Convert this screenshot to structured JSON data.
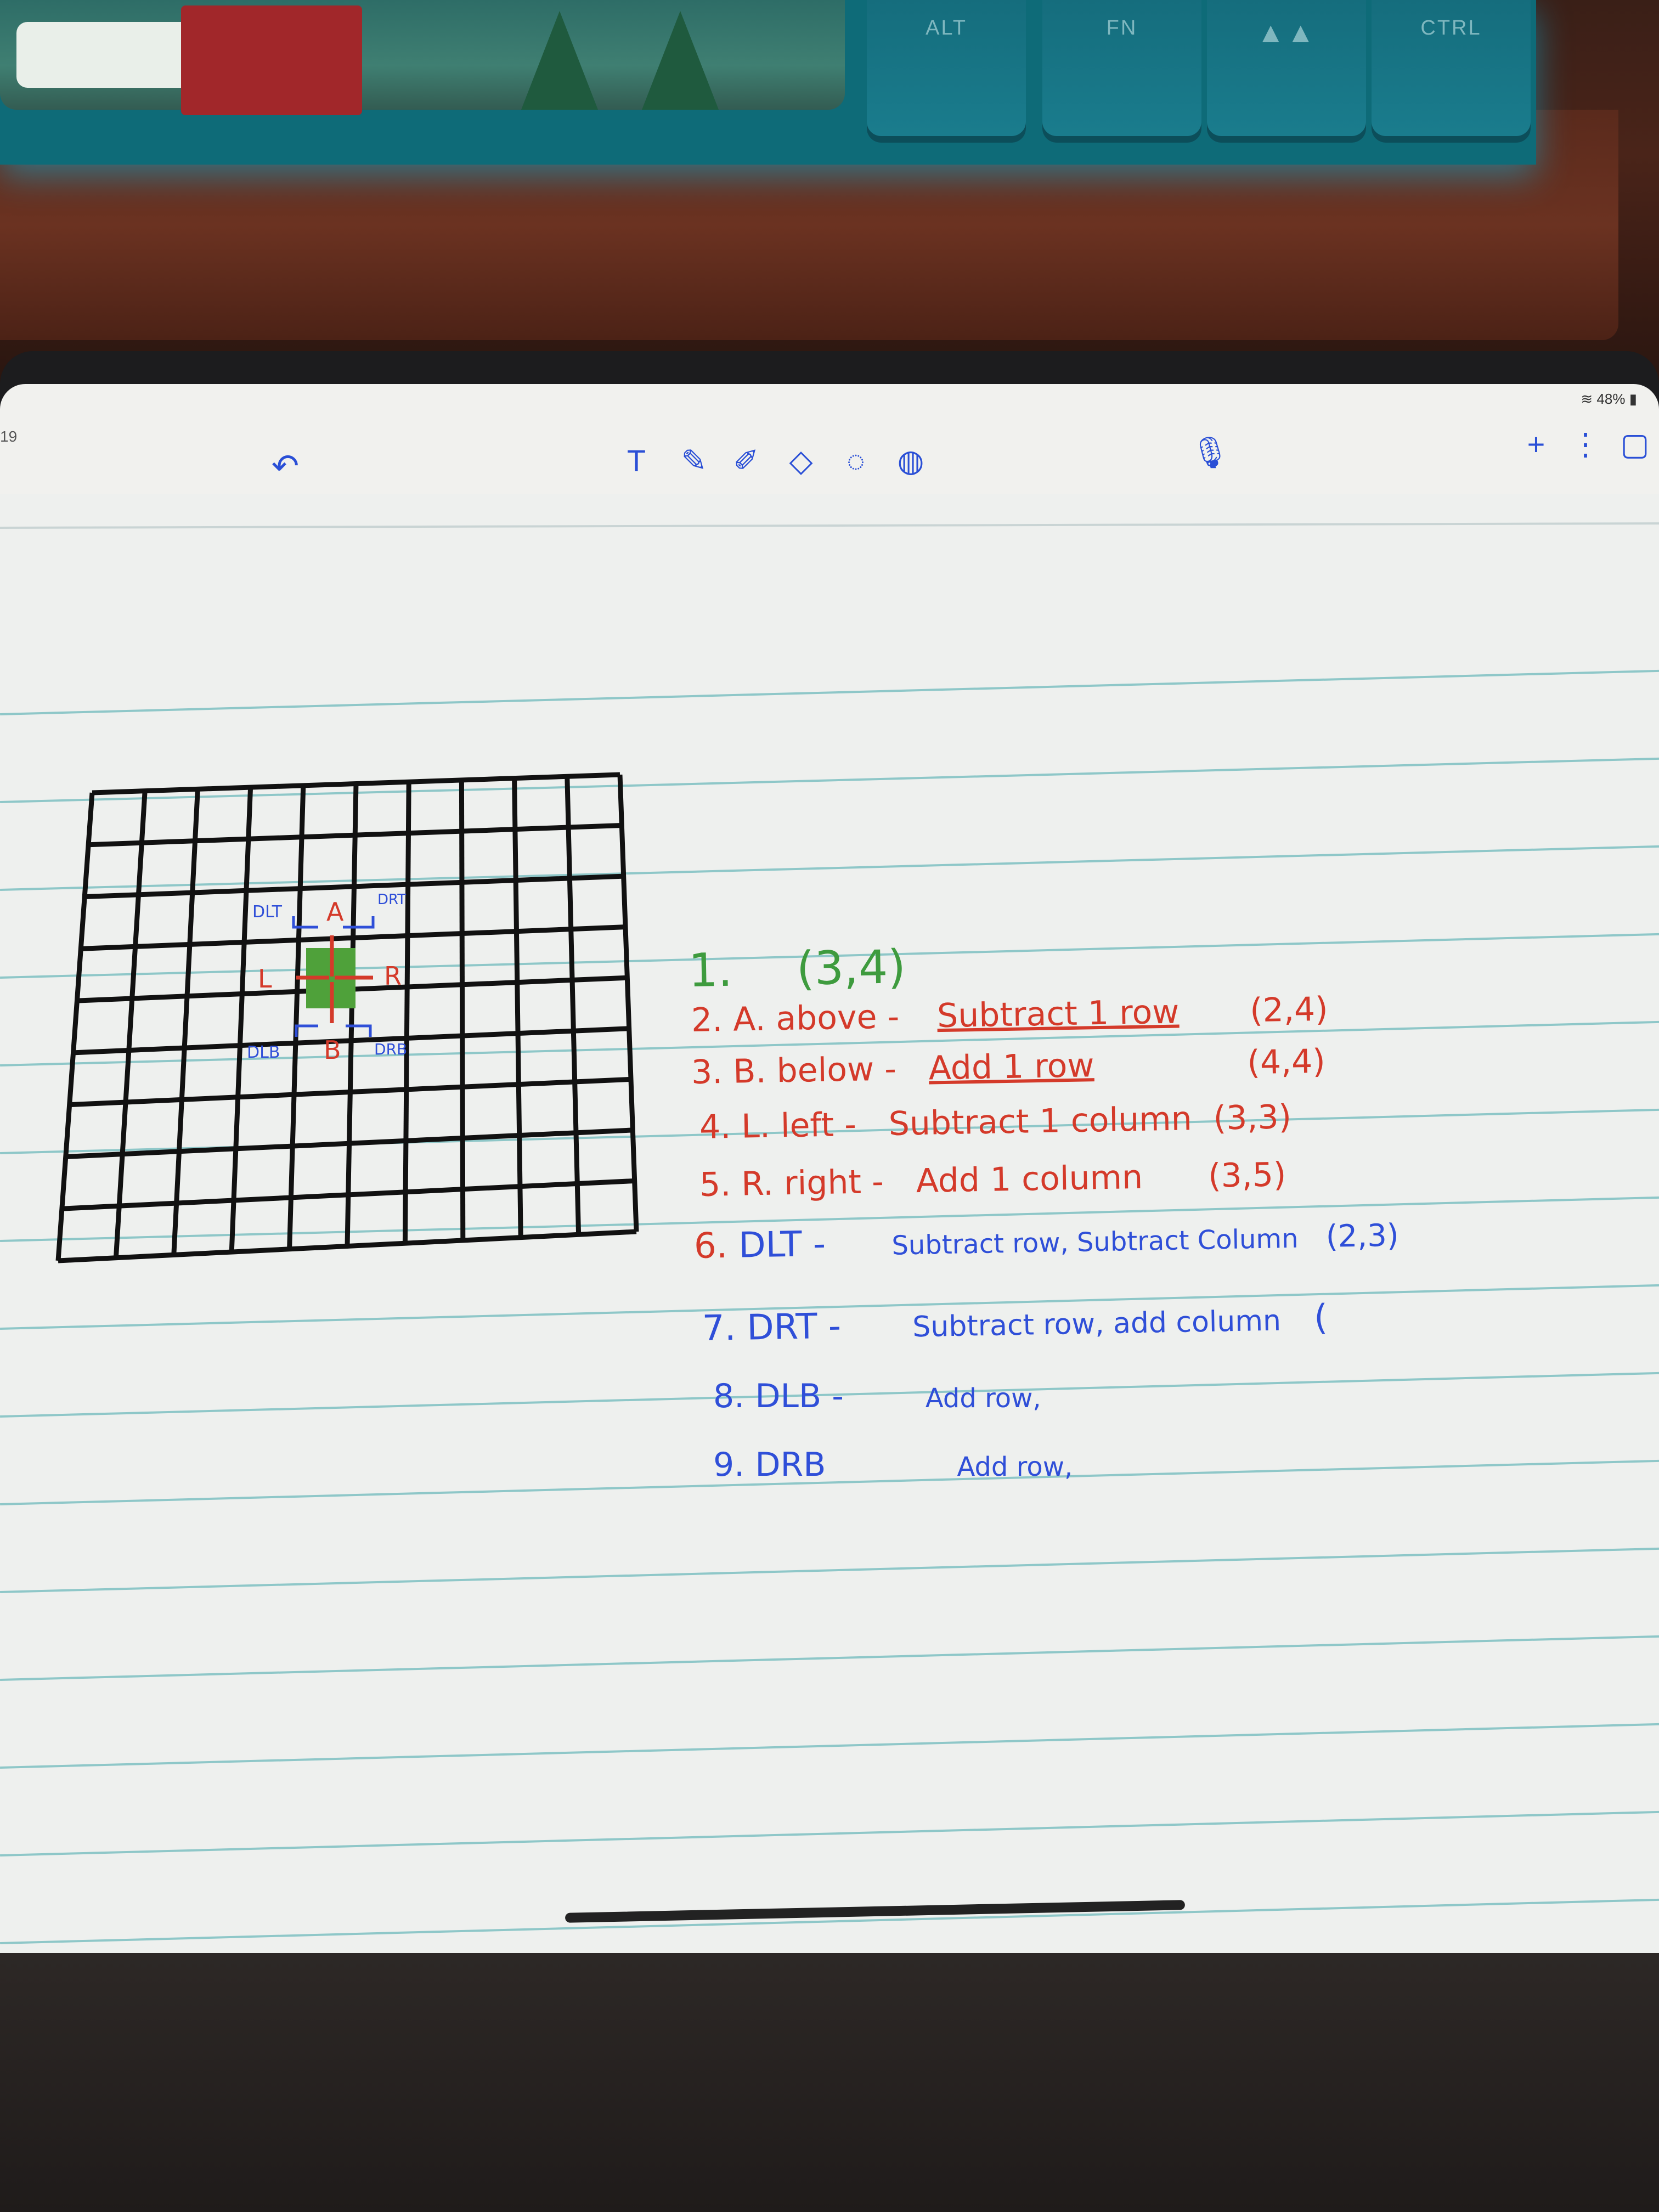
{
  "keyboard": {
    "keys": [
      {
        "label": "ALT"
      },
      {
        "label": "FN"
      },
      {
        "label": ""
      },
      {
        "label": "CTRL"
      }
    ]
  },
  "status": {
    "battery": "48%",
    "clock_fragment": "19"
  },
  "toolbar": {
    "undo_icon": "undo-icon",
    "tools": [
      "text-tool-icon",
      "pen-icon",
      "pencil-icon",
      "eraser-icon",
      "lasso-icon",
      "shape-icon",
      "mic-icon",
      "plus-icon",
      "more-icon",
      "pages-icon"
    ]
  },
  "grid": {
    "rows": 9,
    "cols": 10,
    "labels": {
      "dlt": "DLT",
      "a": "A",
      "drt": "DRT",
      "l": "L",
      "r": "R",
      "dlb": "DLB",
      "b": "B",
      "drb": "DRB"
    }
  },
  "notes": {
    "line1": {
      "num": "1.",
      "text": "(3,4)"
    },
    "line2": {
      "num": "2.",
      "label": "A. above -",
      "rule": "Subtract 1 row",
      "result": "(2,4)"
    },
    "line3": {
      "num": "3.",
      "label": "B. below -",
      "rule": "Add 1 row",
      "result": "(4,4)"
    },
    "line4": {
      "num": "4.",
      "label": "L. left -",
      "rule": "Subtract 1 column",
      "result": "(3,3)"
    },
    "line5": {
      "num": "5.",
      "label": "R. right -",
      "rule": "Add 1 column",
      "result": "(3,5)"
    },
    "line6": {
      "num": "6.",
      "label": "DLT -",
      "rule": "Subtract row, Subtract Column",
      "result": "(2,3)"
    },
    "line7": {
      "num": "7.",
      "label": "DRT -",
      "rule": "Subtract row, add column",
      "result": "("
    },
    "line8": {
      "num": "8.",
      "label": "DLB -",
      "rule": "Add row,"
    },
    "line9": {
      "num": "9.",
      "label": "DRB",
      "rule": "Add row,"
    }
  }
}
